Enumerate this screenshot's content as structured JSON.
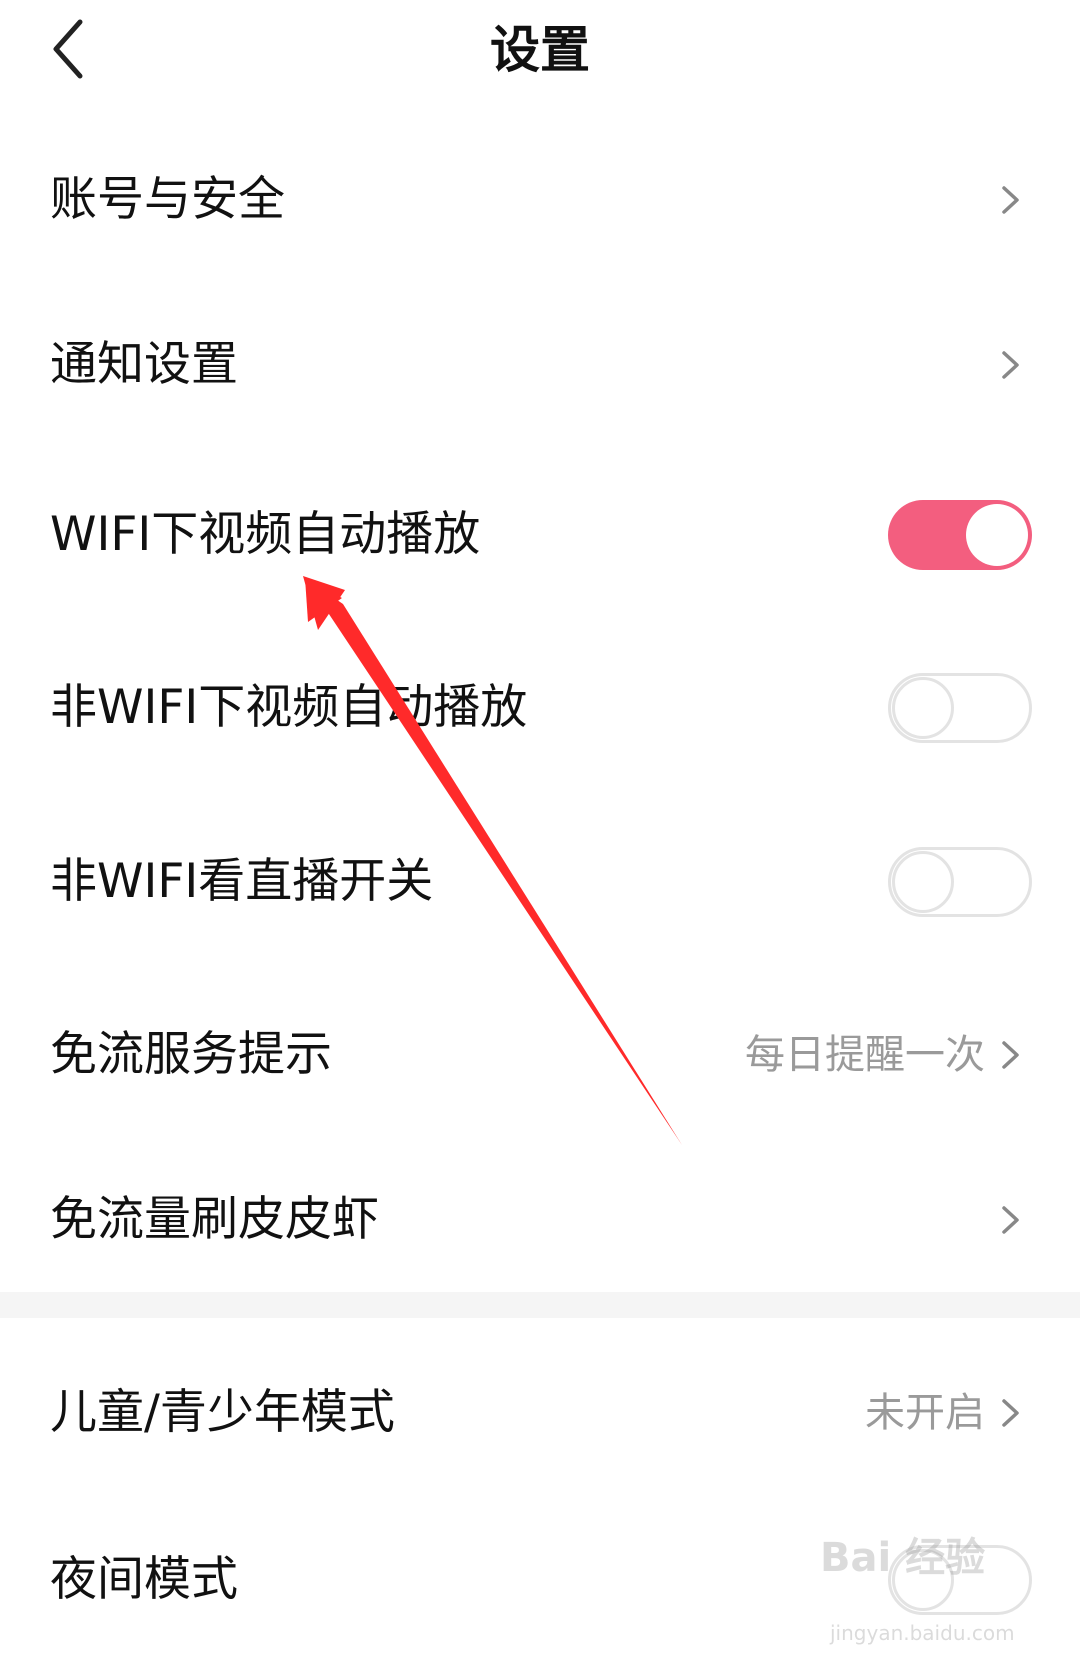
{
  "header": {
    "title": "设置",
    "back_icon": "chevron-left-icon"
  },
  "rows": [
    {
      "label": "账号与安全",
      "control": "chevron"
    },
    {
      "label": "通知设置",
      "control": "chevron"
    },
    {
      "label": "WIFI下视频自动播放",
      "control": "toggle",
      "toggle_on": true
    },
    {
      "label": "非WIFI下视频自动播放",
      "control": "toggle",
      "toggle_on": false
    },
    {
      "label": "非WIFI看直播开关",
      "control": "toggle",
      "toggle_on": false
    },
    {
      "label": "免流服务提示",
      "control": "chevron",
      "value": "每日提醒一次"
    },
    {
      "label": "免流量刷皮皮虾",
      "control": "chevron"
    },
    {
      "label": "儿童/青少年模式",
      "control": "chevron",
      "value": "未开启"
    },
    {
      "label": "夜间模式",
      "control": "toggle",
      "toggle_on": false
    }
  ],
  "colors": {
    "accent": "#f35e7f",
    "annotation_arrow": "#ff2a2a",
    "value_text": "#9a9a9a"
  },
  "watermark": {
    "brand": "Bai 经验",
    "url": "jingyan.baidu.com"
  }
}
